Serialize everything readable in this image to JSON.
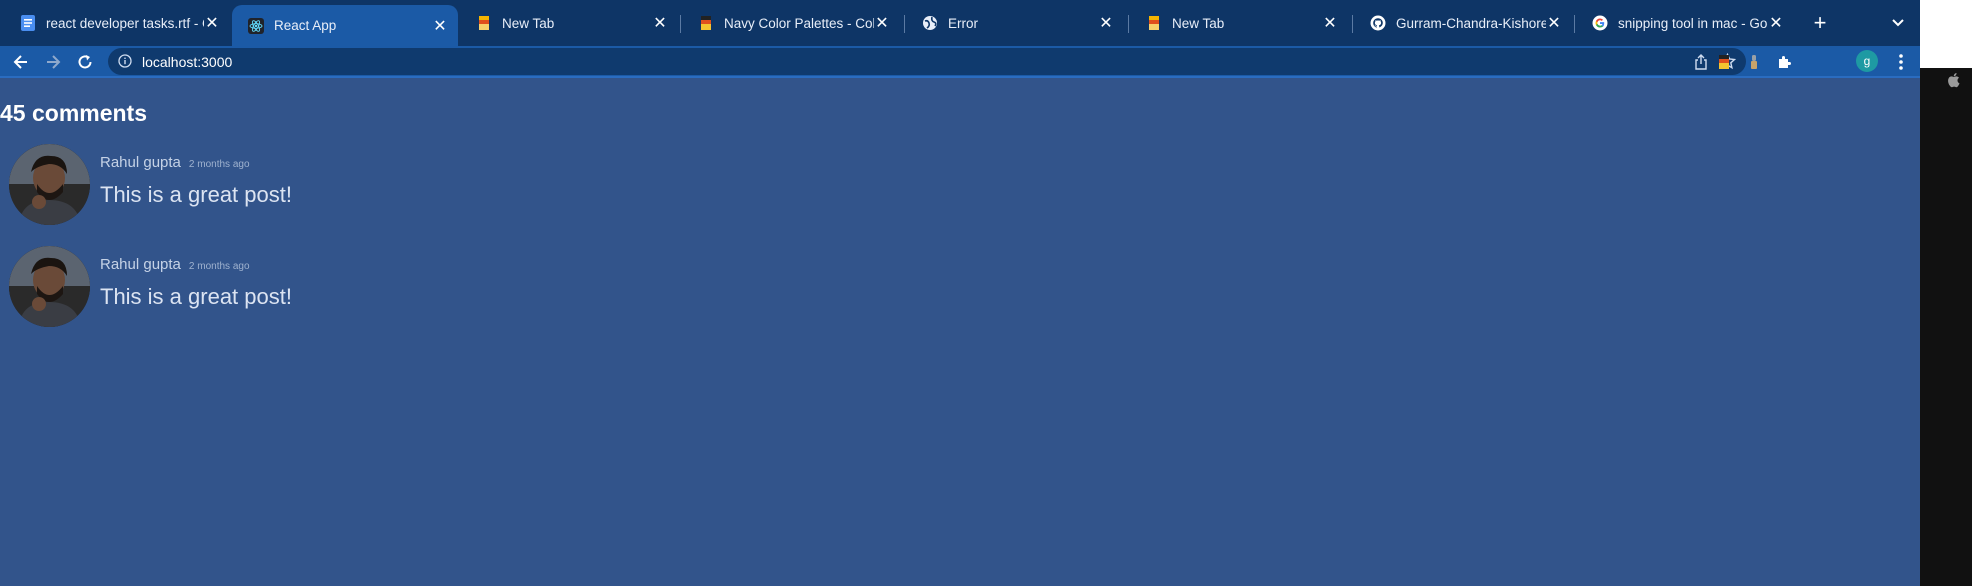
{
  "tabs": [
    {
      "title": "react developer tasks.rtf - G",
      "icon": "docs-icon",
      "active": false
    },
    {
      "title": "React App",
      "icon": "react-icon",
      "active": true
    },
    {
      "title": "New Tab",
      "icon": "palette-icon",
      "active": false
    },
    {
      "title": "Navy Color Palettes - Color I",
      "icon": "palette-icon",
      "active": false
    },
    {
      "title": "Error",
      "icon": "globe-icon",
      "active": false
    },
    {
      "title": "New Tab",
      "icon": "palette-icon",
      "active": false
    },
    {
      "title": "Gurram-Chandra-Kishore-R",
      "icon": "github-icon",
      "active": false
    },
    {
      "title": "snipping tool in mac - Googl",
      "icon": "google-icon",
      "active": false
    }
  ],
  "address": {
    "url": "localhost:3000"
  },
  "profile": {
    "initial": "g"
  },
  "page": {
    "count_label": "45 comments",
    "comments": [
      {
        "author": "Rahul gupta",
        "time": "2 months ago",
        "text": "This is a great post!"
      },
      {
        "author": "Rahul gupta",
        "time": "2 months ago",
        "text": "This is a great post!"
      }
    ]
  },
  "colors": {
    "page_bg": "#32548b",
    "tabstrip_bg": "#0e3566",
    "active_tab_bg": "#1b5aa6",
    "omnibox_bg": "#0f3a6e"
  }
}
